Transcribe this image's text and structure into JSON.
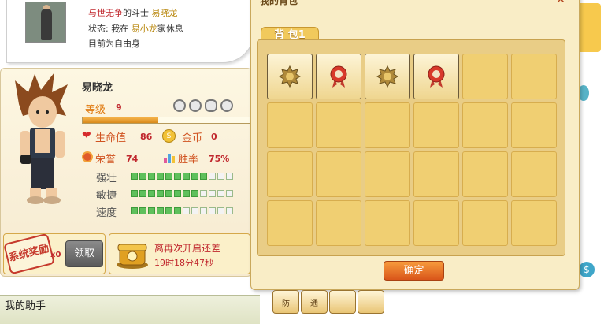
{
  "profile": {
    "line1_prefix": "与世无争",
    "line1_mid": "的斗士",
    "line1_name": "易晓龙",
    "status_prefix": "状态: 我在",
    "status_place": "易小龙",
    "status_suffix": "家休息",
    "current": "目前为自由身"
  },
  "character": {
    "name": "易晓龙",
    "level_label": "等级",
    "level": "9",
    "xp_fraction": 0.45,
    "hp_label": "生命值",
    "hp": "86",
    "gold_label": "金币",
    "gold": "0",
    "honor_label": "荣誉",
    "honor": "74",
    "winrate_label": "胜率",
    "winrate": "75%",
    "attrs": [
      {
        "label": "强壮",
        "filled": 9,
        "total": 12
      },
      {
        "label": "敏捷",
        "filled": 8,
        "total": 12
      },
      {
        "label": "速度",
        "filled": 6,
        "total": 12
      }
    ]
  },
  "reward": {
    "stamp": "系统奖励",
    "count": "x0",
    "claim_label": "领取",
    "chest_line1": "离再次开启还差",
    "chest_line2": "19时18分47秒"
  },
  "helper": {
    "title": "我的助手"
  },
  "bag": {
    "title": "我的背包",
    "tab": "背 包1",
    "confirm": "确定",
    "items": [
      "gear-medal",
      "rosette",
      "gear-medal",
      "rosette"
    ]
  },
  "skills": [
    "防",
    "通",
    "",
    ""
  ],
  "colors": {
    "accent": "#d9551a",
    "gold": "#f0cf72",
    "green": "#5fc05c"
  }
}
